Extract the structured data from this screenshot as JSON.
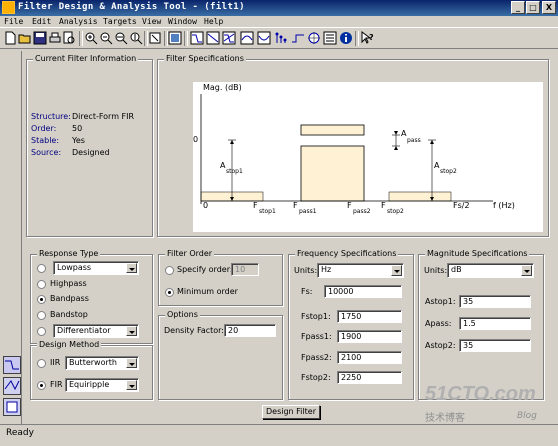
{
  "window": {
    "title": "Filter Design & Analysis Tool -  (filt1)",
    "min_glyph": "_",
    "max_glyph": "□",
    "close_glyph": "X"
  },
  "menu": [
    "File",
    "Edit",
    "Analysis",
    "Targets",
    "View",
    "Window",
    "Help"
  ],
  "toolbar": {
    "icons": [
      "new-icon",
      "open-icon",
      "save-icon",
      "print-icon",
      "print-preview-icon",
      "zoom-in-icon",
      "zoom-out-icon",
      "zoom-x-icon",
      "zoom-y-icon",
      "full-view-icon",
      "magnitude-response-icon",
      "phase-response-icon",
      "magnitude-phase-icon",
      "group-delay-icon",
      "phase-delay-icon",
      "impulse-response-icon",
      "step-response-icon",
      "pole-zero-icon",
      "coefficients-icon",
      "info-icon",
      "whats-this-icon"
    ]
  },
  "current_filter": {
    "group_title": "Current Filter Information",
    "rows": [
      {
        "label": "Structure:",
        "value": "Direct-Form FIR"
      },
      {
        "label": "Order:",
        "value": "50"
      },
      {
        "label": "Stable:",
        "value": "Yes"
      },
      {
        "label": "Source:",
        "value": "Designed"
      }
    ]
  },
  "filter_specs": {
    "group_title": "Filter Specifications",
    "ylabel": "Mag. (dB)",
    "zero": "0",
    "x_zero": "0",
    "xlabel": "f (Hz)",
    "fstop1": "F",
    "fstop1_sub": "stop1",
    "fpass1": "F",
    "fpass1_sub": "pass1",
    "fpass2": "F",
    "fpass2_sub": "pass2",
    "fstop2": "F",
    "fstop2_sub": "stop2",
    "fs2": "Fs/2",
    "astop1": "A",
    "astop1_sub": "stop1",
    "apass": "A",
    "apass_sub": "pass",
    "astop2": "A",
    "astop2_sub": "stop2"
  },
  "response_type": {
    "group_title": "Response Type",
    "lowpass_value": "Lowpass",
    "highpass": "Highpass",
    "bandpass": "Bandpass",
    "bandstop": "Bandstop",
    "other_value": "Differentiator",
    "selected": "Bandpass"
  },
  "design_method": {
    "group_title": "Design Method",
    "iir_label": "IIR",
    "iir_value": "Butterworth",
    "fir_label": "FIR",
    "fir_value": "Equiripple",
    "selected": "FIR"
  },
  "filter_order": {
    "group_title": "Filter Order",
    "specify_label": "Specify order:",
    "specify_value": "10",
    "minimum_label": "Minimum order",
    "selected": "Minimum order"
  },
  "options": {
    "group_title": "Options",
    "density_label": "Density Factor:",
    "density_value": "20"
  },
  "freq_specs": {
    "group_title": "Frequency Specifications",
    "units_label": "Units:",
    "units_value": "Hz",
    "rows": [
      {
        "label": "Fs:",
        "value": "10000"
      },
      {
        "label": "Fstop1:",
        "value": "1750"
      },
      {
        "label": "Fpass1:",
        "value": "1900"
      },
      {
        "label": "Fpass2:",
        "value": "2100"
      },
      {
        "label": "Fstop2:",
        "value": "2250"
      }
    ]
  },
  "mag_specs": {
    "group_title": "Magnitude Specifications",
    "units_label": "Units:",
    "units_value": "dB",
    "rows": [
      {
        "label": "Astop1:",
        "value": "35"
      },
      {
        "label": "Apass:",
        "value": "1.5"
      },
      {
        "label": "Astop2:",
        "value": "35"
      }
    ]
  },
  "design_button": "Design Filter",
  "status": "Ready",
  "watermark": {
    "main": "51CTO.com",
    "sub": "技术博客",
    "blog": "Blog"
  }
}
